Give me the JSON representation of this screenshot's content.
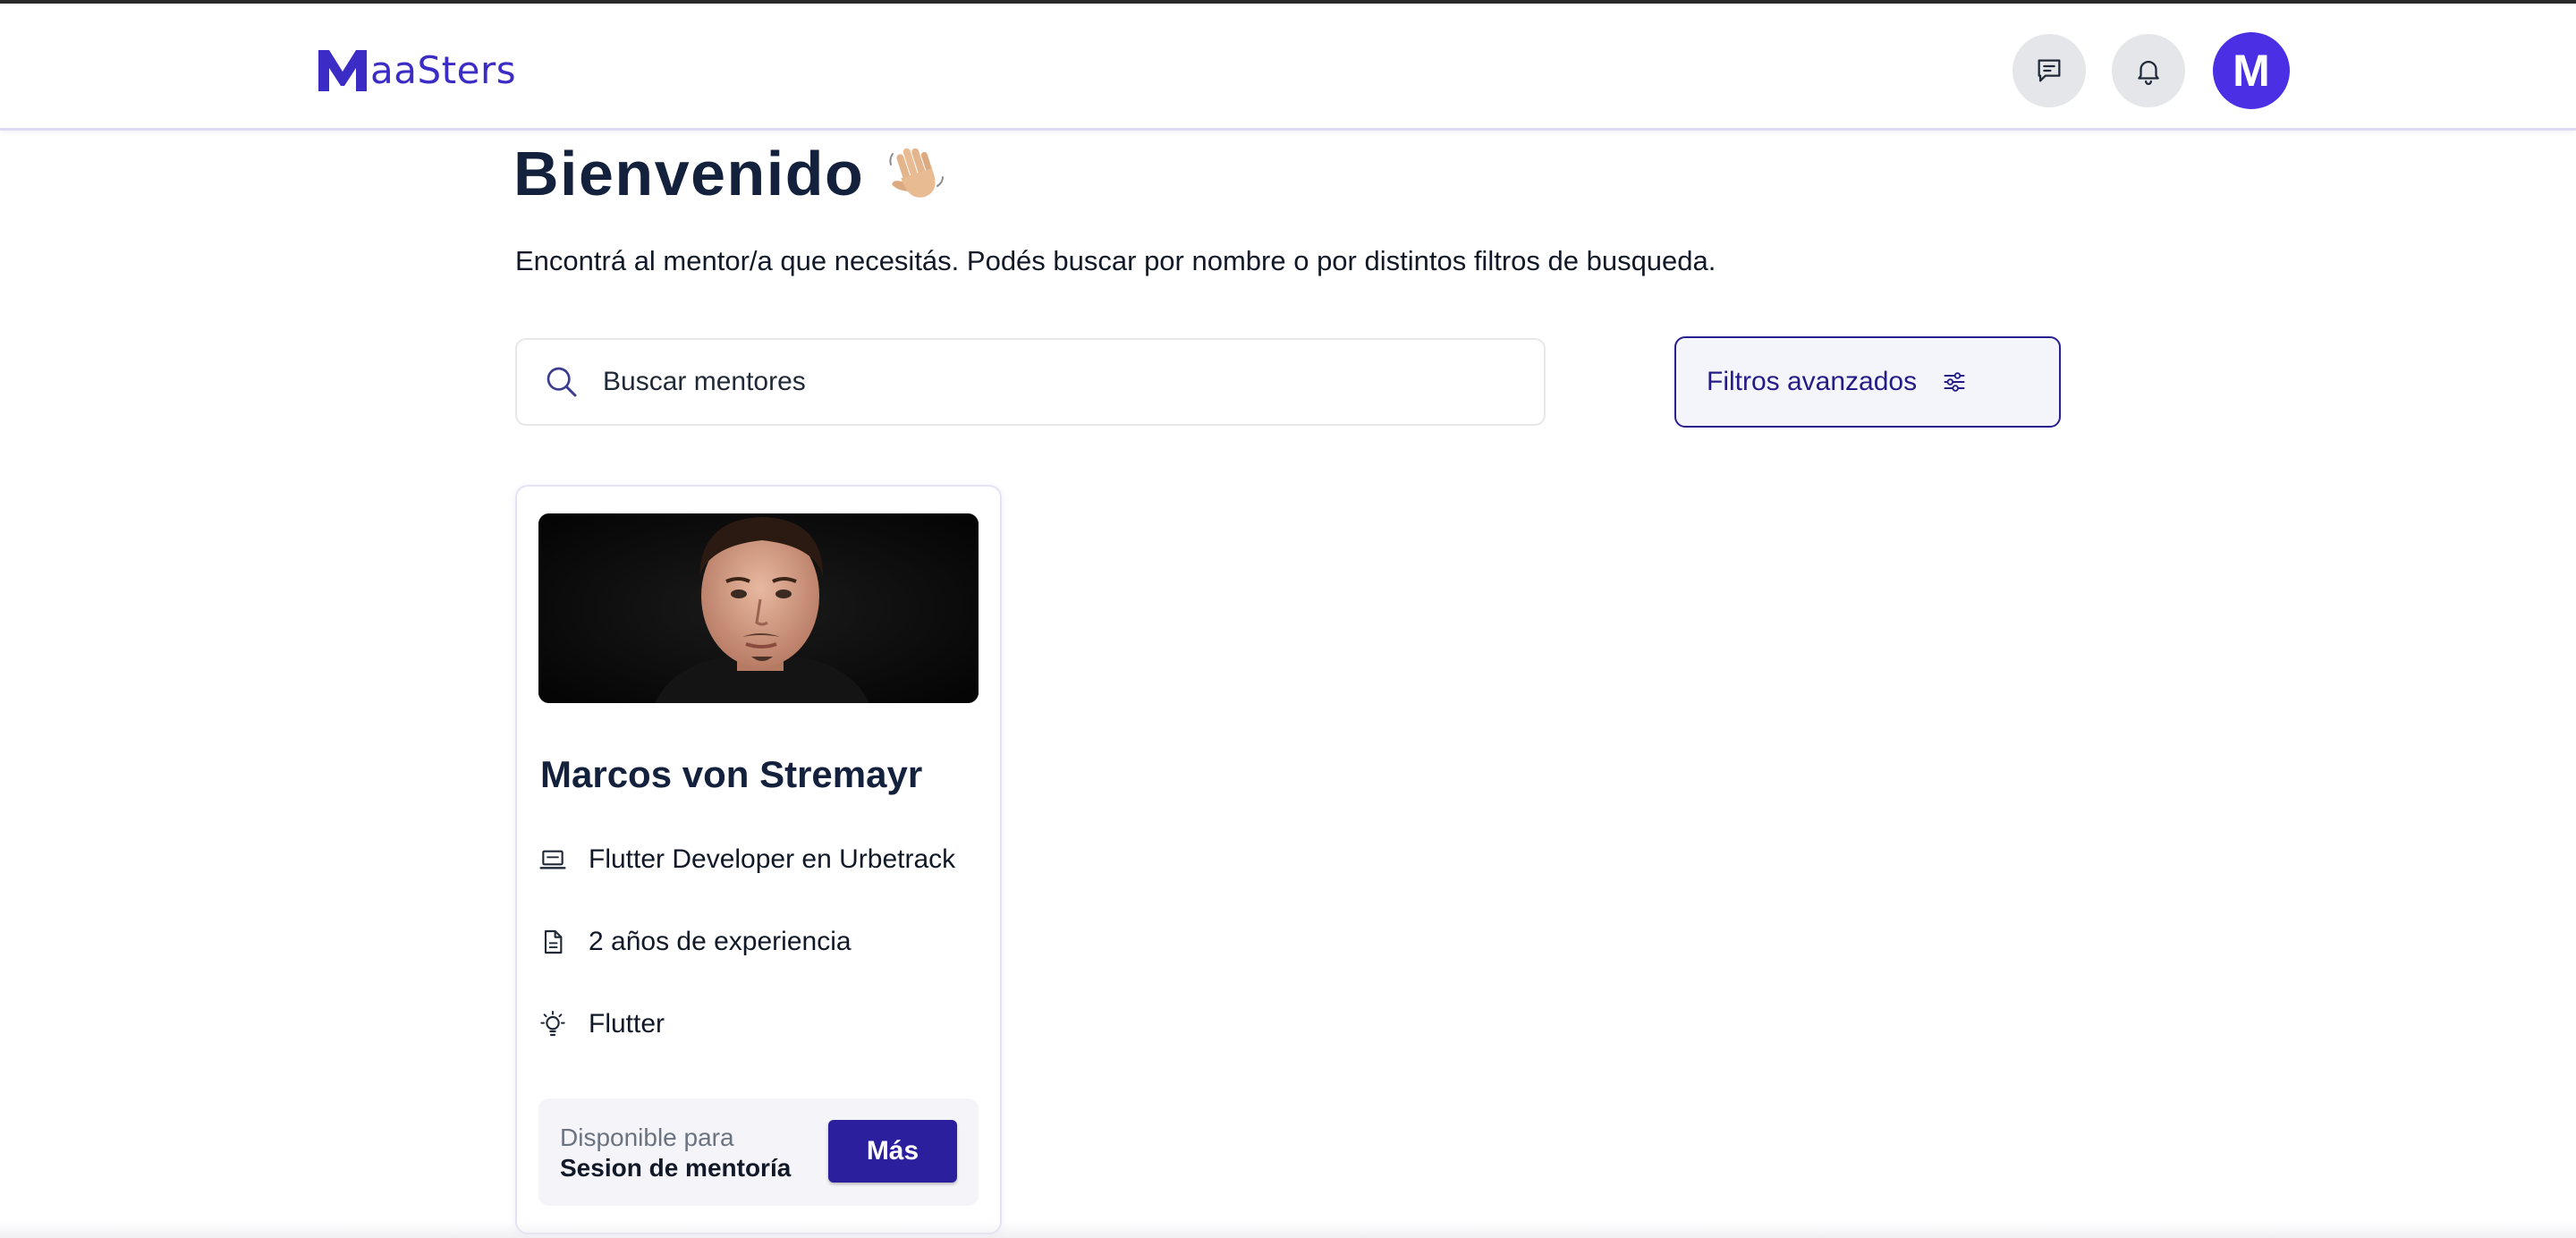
{
  "header": {
    "logo_text": "aaSters",
    "logo_letter": "M",
    "avatar_initial": "M",
    "brand_color": "#3a2cc4",
    "avatar_color": "#4a2fe4"
  },
  "welcome": {
    "title": "Bienvenido",
    "emoji": "waving-hand",
    "subtitle": "Encontrá al mentor/a que necesitás. Podés buscar por nombre o por distintos filtros de busqueda."
  },
  "search": {
    "placeholder": "Buscar mentores",
    "value": ""
  },
  "filters": {
    "label": "Filtros avanzados"
  },
  "mentors": [
    {
      "name": "Marcos von Stremayr",
      "role": "Flutter Developer en Urbetrack",
      "experience": "2 años de experiencia",
      "skill": "Flutter",
      "availability_label": "Disponible para",
      "availability_value": "Sesion de mentoría",
      "more_label": "Más"
    }
  ],
  "icons": {
    "chat": "chat-icon",
    "bell": "bell-icon",
    "search": "search-icon",
    "filters": "sliders-icon",
    "role": "laptop-icon",
    "experience": "document-icon",
    "skill": "lightbulb-icon"
  },
  "colors": {
    "primary_button": "#2b1f9e",
    "title_text": "#14213d"
  }
}
